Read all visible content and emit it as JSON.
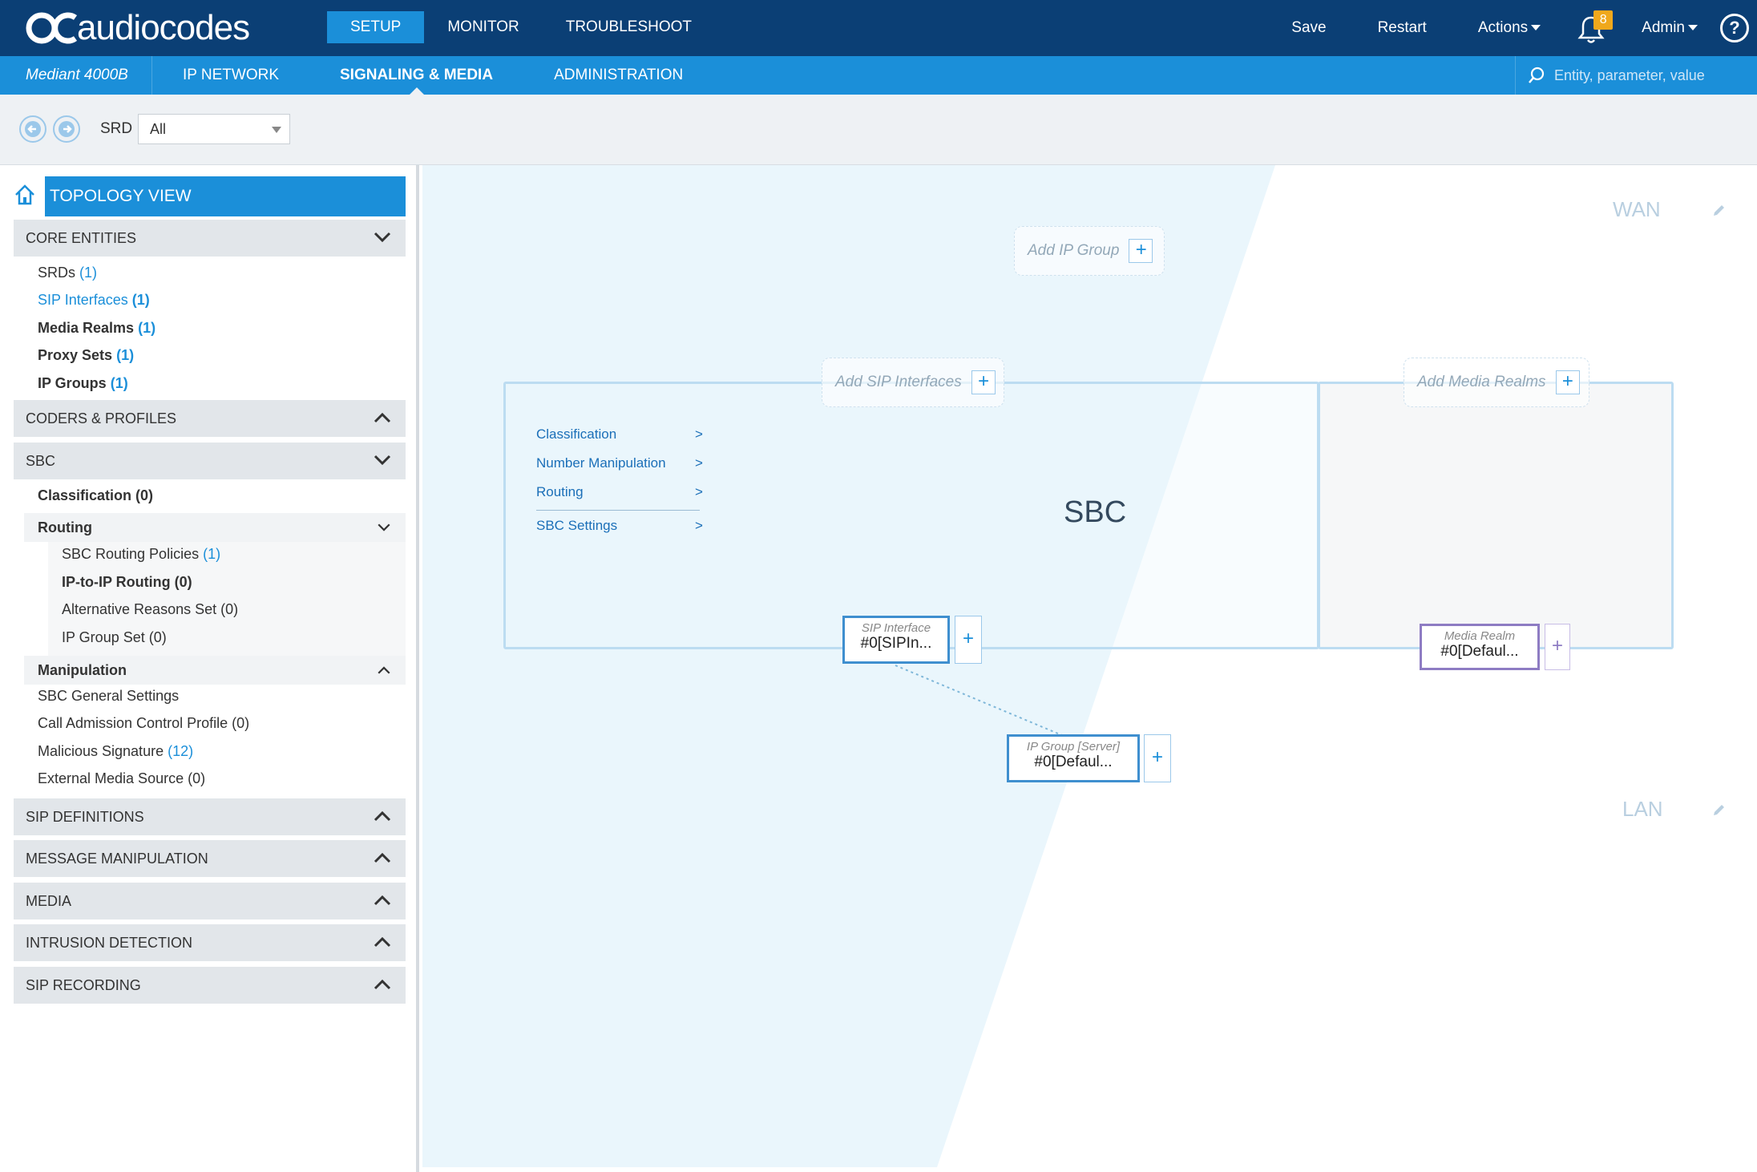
{
  "brand": {
    "name": "audiocodes"
  },
  "colors": {
    "topbar": "#0b3f75",
    "accent": "#1b8fd9",
    "badge": "#f0a81c",
    "media_realm": "#8e7cc3"
  },
  "topnav": {
    "tabs": [
      "SETUP",
      "MONITOR",
      "TROUBLESHOOT"
    ],
    "active": "SETUP",
    "save": "Save",
    "restart": "Restart",
    "actions": "Actions",
    "notifications": "8",
    "user": "Admin",
    "help": "?"
  },
  "subnav": {
    "device": "Mediant 4000B",
    "tabs": [
      "IP NETWORK",
      "SIGNALING & MEDIA",
      "ADMINISTRATION"
    ],
    "active": "SIGNALING & MEDIA",
    "search_placeholder": "Entity, parameter, value"
  },
  "toolbar": {
    "srd_label": "SRD",
    "srd_value": "All"
  },
  "sidebar": {
    "title": "TOPOLOGY VIEW",
    "sections": {
      "core": "CORE ENTITIES",
      "coders": "CODERS & PROFILES",
      "sbc": "SBC",
      "sipdef": "SIP DEFINITIONS",
      "msgmanip": "MESSAGE MANIPULATION",
      "media": "MEDIA",
      "intrusion": "INTRUSION DETECTION",
      "siprec": "SIP RECORDING"
    },
    "core_items": [
      {
        "label": "SRDs",
        "count": "(1)"
      },
      {
        "label": "SIP Interfaces",
        "count": "(1)"
      },
      {
        "label": "Media Realms",
        "count": "(1)"
      },
      {
        "label": "Proxy Sets",
        "count": "(1)"
      },
      {
        "label": "IP Groups",
        "count": "(1)"
      }
    ],
    "sbc_items": {
      "classification": "Classification (0)",
      "routing": "Routing",
      "routing_items": [
        {
          "label": "SBC Routing Policies",
          "count": "(1)"
        },
        {
          "label": "IP-to-IP Routing (0)"
        },
        {
          "label": "Alternative Reasons Set (0)"
        },
        {
          "label": "IP Group Set (0)"
        }
      ],
      "manipulation": "Manipulation",
      "general": "SBC General Settings",
      "cac": "Call Admission Control Profile (0)",
      "malicious": {
        "label": "Malicious Signature",
        "count": "(12)"
      },
      "external": "External Media Source (0)"
    }
  },
  "topology": {
    "wan": "WAN",
    "lan": "LAN",
    "add_ip_group": "Add IP Group",
    "add_sip_interfaces": "Add SIP Interfaces",
    "add_media_realms": "Add Media Realms",
    "sbc_title": "SBC",
    "sbc_menu": [
      "Classification",
      "Number Manipulation",
      "Routing",
      "SBC Settings"
    ],
    "arrow": ">",
    "plus": "+",
    "sip_interface": {
      "title": "SIP Interface",
      "value": "#0[SIPIn..."
    },
    "media_realm": {
      "title": "Media Realm",
      "value": "#0[Defaul..."
    },
    "ip_group": {
      "title": "IP Group [Server]",
      "value": "#0[Defaul..."
    }
  }
}
